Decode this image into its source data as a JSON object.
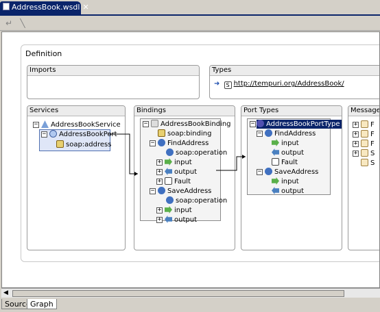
{
  "editor": {
    "tab_title": "AddressBook.wsdl",
    "close_glyph": "✕"
  },
  "toolbar": {
    "back_icon": "back-arrow-icon",
    "link_icon": "link-icon"
  },
  "definition": {
    "title": "Definition"
  },
  "imports": {
    "title": "Imports"
  },
  "types": {
    "title": "Types",
    "link": "http://tempuri.org/AddressBook/",
    "schema_badge": "S"
  },
  "services": {
    "title": "Services",
    "service": "AddressBookService",
    "port": "AddressBookPort",
    "address": "soap:address"
  },
  "bindings": {
    "title": "Bindings",
    "binding": "AddressBookBinding",
    "soap_binding": "soap:binding",
    "op1": "FindAddress",
    "op1_soap": "soap:operation",
    "op1_input": "input",
    "op1_output": "output",
    "op1_fault": "Fault",
    "op2": "SaveAddress",
    "op2_soap": "soap:operation",
    "op2_input": "input",
    "op2_output": "output"
  },
  "port_types": {
    "title": "Port Types",
    "port_type": "AddressBookPortType",
    "op1": "FindAddress",
    "op1_input": "input",
    "op1_output": "output",
    "op1_fault": "Fault",
    "op2": "SaveAddress",
    "op2_input": "input",
    "op2_output": "output"
  },
  "messages": {
    "title": "Message",
    "items": [
      "F",
      "F",
      "F",
      "S",
      "S"
    ]
  },
  "bottom_tabs": {
    "source": "Source",
    "graph": "Graph"
  }
}
